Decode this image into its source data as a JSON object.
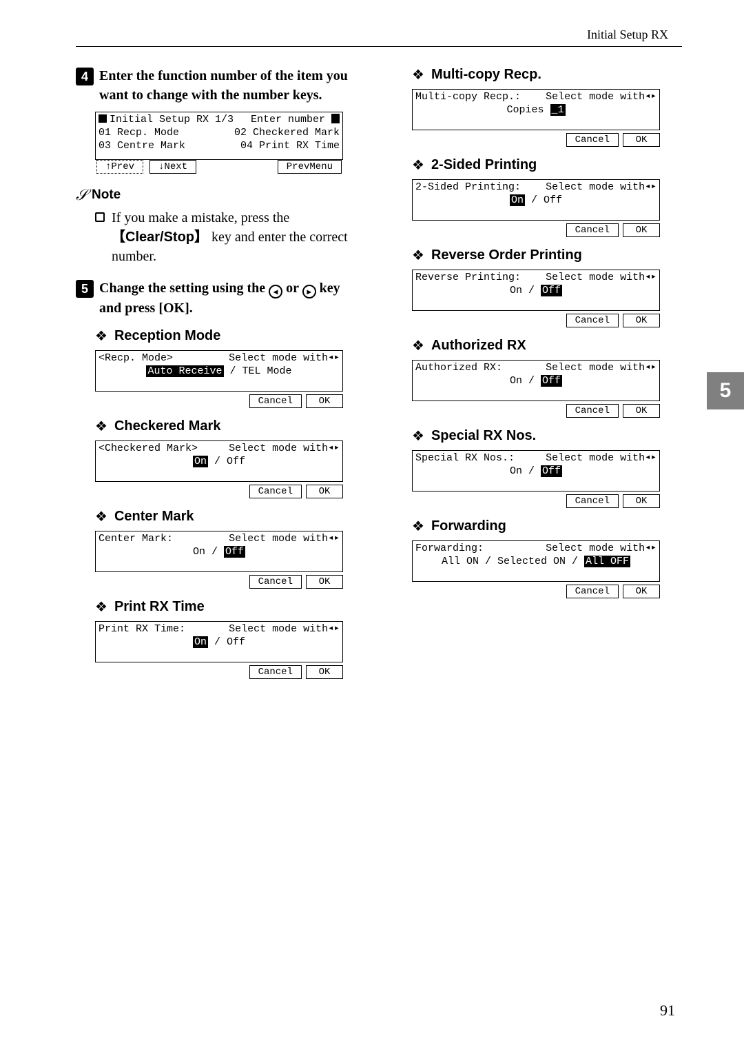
{
  "header": {
    "title": "Initial Setup RX"
  },
  "side_tab": "5",
  "page_number": "91",
  "step4": {
    "num": "4",
    "text": "Enter the function number of the item you want to change with the number keys."
  },
  "lcd_menu": {
    "title": "Initial Setup RX 1/3",
    "prompt": "Enter number",
    "row1a": "01 Recp. Mode",
    "row1b": "02 Checkered Mark",
    "row2a": "03 Centre Mark",
    "row2b": "04 Print RX Time",
    "prev_btn": "↑Prev",
    "next_btn": "↓Next",
    "prevmenu_btn": "PrevMenu"
  },
  "note": {
    "label": "Note",
    "text_a": "If you make a mistake, press the ",
    "key": "Clear/Stop",
    "text_b": " key and enter the correct number."
  },
  "step5": {
    "num": "5",
    "text_a": "Change the setting using the ",
    "text_b": " or ",
    "text_c": " key and press [OK]."
  },
  "buttons": {
    "cancel": "Cancel",
    "ok": "OK"
  },
  "select_hint": "Select mode with",
  "panels": {
    "reception": {
      "heading": "Reception Mode",
      "title": "<Recp. Mode>",
      "val_sel": "Auto Receive",
      "val_rest": " / TEL Mode"
    },
    "checkered": {
      "heading": "Checkered Mark",
      "title": "<Checkered Mark>",
      "val_sel": "On",
      "val_rest": " / Off"
    },
    "center": {
      "heading": "Center Mark",
      "title": "Center Mark:",
      "val_pre": "On / ",
      "val_sel": "Off"
    },
    "printrx": {
      "heading": "Print RX Time",
      "title": "Print RX Time:",
      "val_sel": "On",
      "val_rest": " / Off"
    },
    "multicopy": {
      "heading": "Multi-copy Recp.",
      "title": "Multi-copy Recp.:",
      "val_label": "Copies ",
      "val_sel": "_1"
    },
    "twosided": {
      "heading": "2-Sided Printing",
      "title": "2-Sided Printing:",
      "val_sel": "On",
      "val_rest": " / Off"
    },
    "reverse": {
      "heading": "Reverse Order Printing",
      "title": "Reverse Printing:",
      "val_pre": "On / ",
      "val_sel": "Off"
    },
    "authorized": {
      "heading": "Authorized RX",
      "title": "Authorized RX:",
      "val_pre": "On / ",
      "val_sel": "Off"
    },
    "special": {
      "heading": "Special RX Nos.",
      "title": "Special RX Nos.:",
      "val_pre": "On / ",
      "val_sel": "Off"
    },
    "forwarding": {
      "heading": "Forwarding",
      "title": "Forwarding:",
      "val_pre": "All ON / Selected ON / ",
      "val_sel": "All OFF"
    }
  }
}
